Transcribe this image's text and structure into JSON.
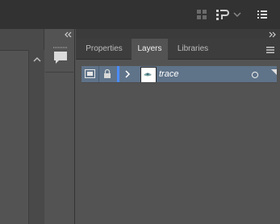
{
  "panel": {
    "tabs": [
      {
        "label": "Properties"
      },
      {
        "label": "Layers"
      },
      {
        "label": "Libraries"
      }
    ],
    "active_tab": "Layers"
  },
  "layers": [
    {
      "name": "trace",
      "visible": true,
      "locked": false,
      "color": "#4a8cff"
    }
  ],
  "colors": {
    "app_bar": "#323232",
    "panel_bg": "#535353",
    "tab_bar": "#3d3d3d",
    "selected_row": "#5f7389",
    "layer_color": "#4a8cff"
  }
}
